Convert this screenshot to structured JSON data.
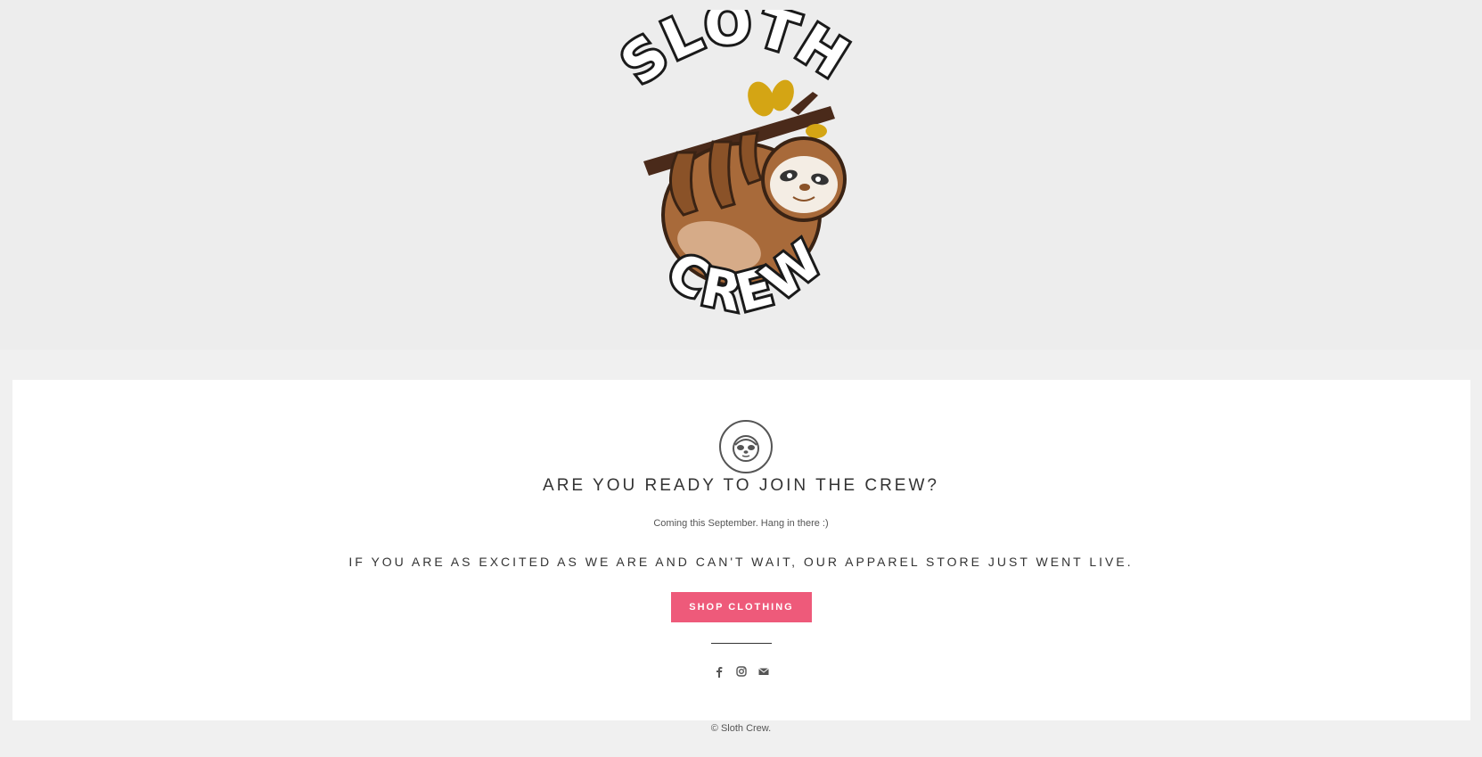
{
  "logo": {
    "top_text": "SLOTH",
    "bottom_text": "CREW"
  },
  "badge": {
    "icon": "sloth-face-icon"
  },
  "main": {
    "headline": "ARE YOU READY TO JOIN THE CREW?",
    "subtext": "Coming this September. Hang in there :)",
    "excited_text": "IF YOU ARE AS EXCITED AS WE ARE AND CAN'T WAIT, OUR APPAREL STORE JUST WENT LIVE.",
    "shop_button_label": "SHOP CLOTHING"
  },
  "social": {
    "icons": [
      "facebook-icon",
      "instagram-icon",
      "envelope-icon"
    ]
  },
  "footer": {
    "copyright": "© Sloth Crew."
  },
  "colors": {
    "accent": "#ee5a7a",
    "background": "#f0f0f0",
    "card": "#ffffff",
    "text": "#333333"
  }
}
